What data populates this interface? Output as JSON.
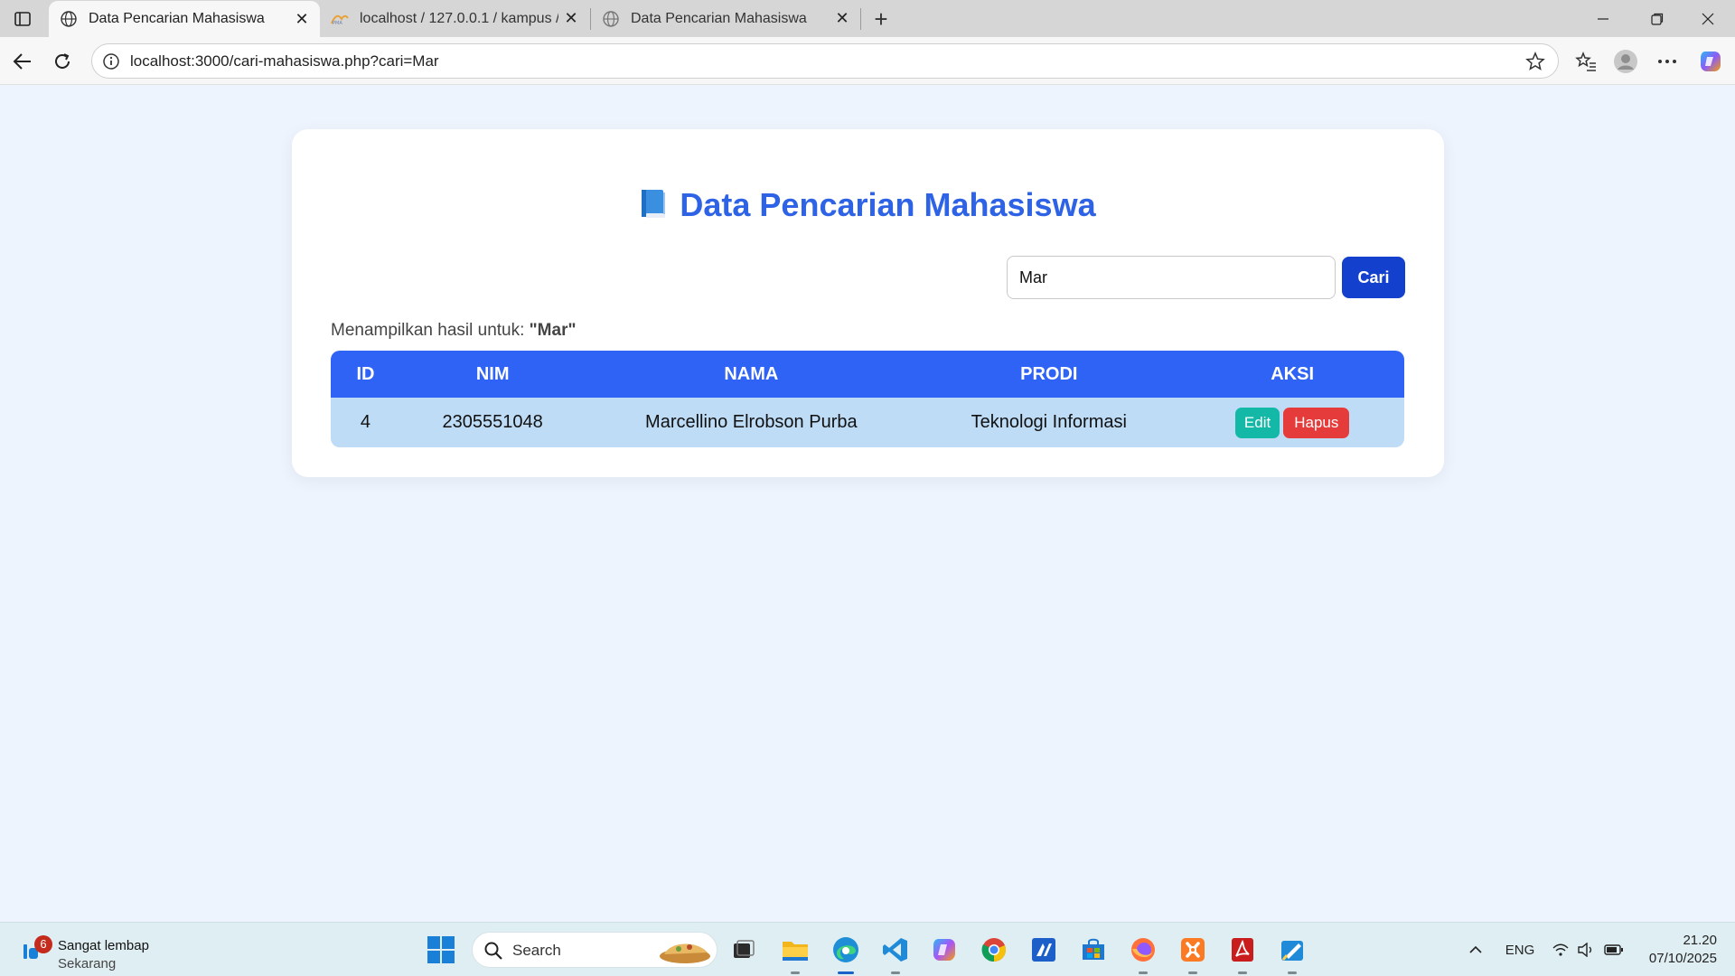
{
  "browser": {
    "tabs": [
      {
        "title": "Data Pencarian Mahasiswa",
        "active": true
      },
      {
        "title": "localhost / 127.0.0.1 / kampus / m",
        "active": false
      },
      {
        "title": "Data Pencarian Mahasiswa",
        "active": false
      }
    ],
    "url": "localhost:3000/cari-mahasiswa.php?cari=Mar"
  },
  "page": {
    "title": "Data Pencarian Mahasiswa",
    "search": {
      "value": "Mar",
      "button_label": "Cari"
    },
    "result_prefix": "Menampilkan hasil untuk:",
    "result_query": "\"Mar\"",
    "table": {
      "headers": [
        "ID",
        "NIM",
        "NAMA",
        "PRODI",
        "AKSI"
      ],
      "rows": [
        {
          "id": "4",
          "nim": "2305551048",
          "nama": "Marcellino Elrobson Purba",
          "prodi": "Teknologi Informasi",
          "edit": "Edit",
          "hapus": "Hapus"
        }
      ]
    },
    "colors": {
      "title": "#2e63e6",
      "header_bg": "#2e63f6",
      "row_bg": "#bedcf6",
      "edit": "#14b8a6",
      "hapus": "#e63b3b",
      "cari": "#1340cc"
    }
  },
  "taskbar": {
    "weather_title": "Sangat lembap",
    "weather_sub": "Sekarang",
    "weather_badge": "6",
    "search_placeholder": "Search",
    "language": "ENG",
    "time": "21.20",
    "date": "07/10/2025",
    "apps": [
      "task-view-icon",
      "file-explorer-icon",
      "edge-icon",
      "vscode-icon",
      "copilot-icon",
      "chrome-icon",
      "app-icon",
      "store-icon",
      "firefox-icon",
      "xampp-icon",
      "acrobat-icon",
      "paint-icon"
    ]
  }
}
